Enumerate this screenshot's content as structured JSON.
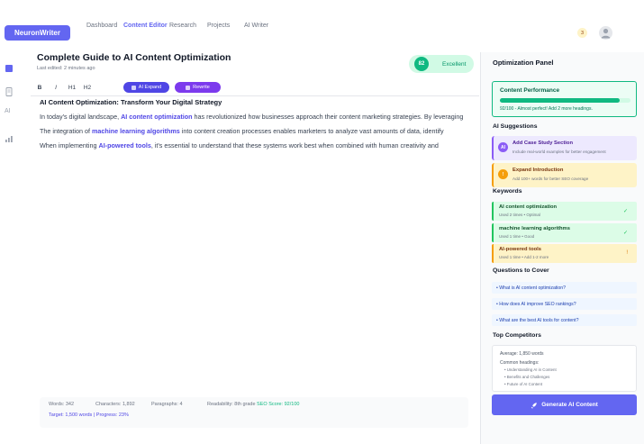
{
  "nav": {
    "logo": "NeuronWriter",
    "links": [
      "Dashboard",
      "Content Editor",
      "Research",
      "Projects",
      "AI Writer"
    ],
    "active_index": 1,
    "notifications": "3"
  },
  "rail": {
    "ai_label": "AI"
  },
  "editor": {
    "title": "Complete Guide to AI Content Optimization",
    "subtitle": "Last edited: 2 minutes ago",
    "score": "82",
    "score_label": "Excellent",
    "toolbar": {
      "bold": "B",
      "italic": "I",
      "h1": "H1",
      "h2": "H2",
      "ai_expand": "AI Expand",
      "rewrite": "Rewrite"
    },
    "heading": "AI Content Optimization: Transform Your Digital Strategy",
    "paragraphs": [
      {
        "before": "In today's digital landscape, ",
        "keyword": "AI content optimization",
        "after": " has revolutionized how businesses approach their content marketing strategies. By leveraging"
      },
      {
        "before": "The integration of ",
        "keyword": "machine learning algorithms",
        "after": " into content creation processes enables marketers to analyze vast amounts of data, identify"
      },
      {
        "before": "When implementing ",
        "keyword": "AI-powered tools",
        "after": ", it's essential to understand that these systems work best when combined with human creativity and"
      }
    ]
  },
  "stats": {
    "words": "Words: 342",
    "characters": "Characters: 1,892",
    "paragraphs": "Paragraphs: 4",
    "readability": "Readability: 8th grade",
    "seo": "SEO Score: 92/100",
    "target": "Target: 1,500 words | Progress: 23%"
  },
  "panel": {
    "title": "Optimization Panel",
    "performance": {
      "title": "Content Performance",
      "progress": 0.92,
      "text": "92/100 - Almost perfect! Add 2 more headings."
    },
    "ai_suggestions_title": "AI Suggestions",
    "suggestions": [
      {
        "icon": "AI",
        "title": "Add Case Study Section",
        "desc": "Include real-world examples for better engagement"
      },
      {
        "icon": "!",
        "title": "Expand Introduction",
        "desc": "Add 100+ words for better SEO coverage"
      }
    ],
    "keywords_title": "Keywords",
    "keywords": [
      {
        "name": "AI content optimization",
        "meta": "Used 2 times • Optimal",
        "status": "✓"
      },
      {
        "name": "machine learning algorithms",
        "meta": "Used 1 time • Good",
        "status": "✓"
      },
      {
        "name": "AI-powered tools",
        "meta": "Used 1 time • Add 1-2 more",
        "status": "!"
      }
    ],
    "questions_title": "Questions to Cover",
    "questions": [
      "• What is AI content optimization?",
      "• How does AI improve SEO rankings?",
      "• What are the best AI tools for content?"
    ],
    "competitors_title": "Top Competitors",
    "competitors": {
      "average": "Average: 1,850 words",
      "headings_label": "Common headings:",
      "headings": [
        "• Understanding AI in Content",
        "• Benefits and Challenges",
        "• Future of AI Content"
      ]
    },
    "generate_button": "Generate AI Content"
  },
  "colors": {
    "accent": "#6366f1",
    "success": "#10b981",
    "warning": "#f59e0b"
  }
}
